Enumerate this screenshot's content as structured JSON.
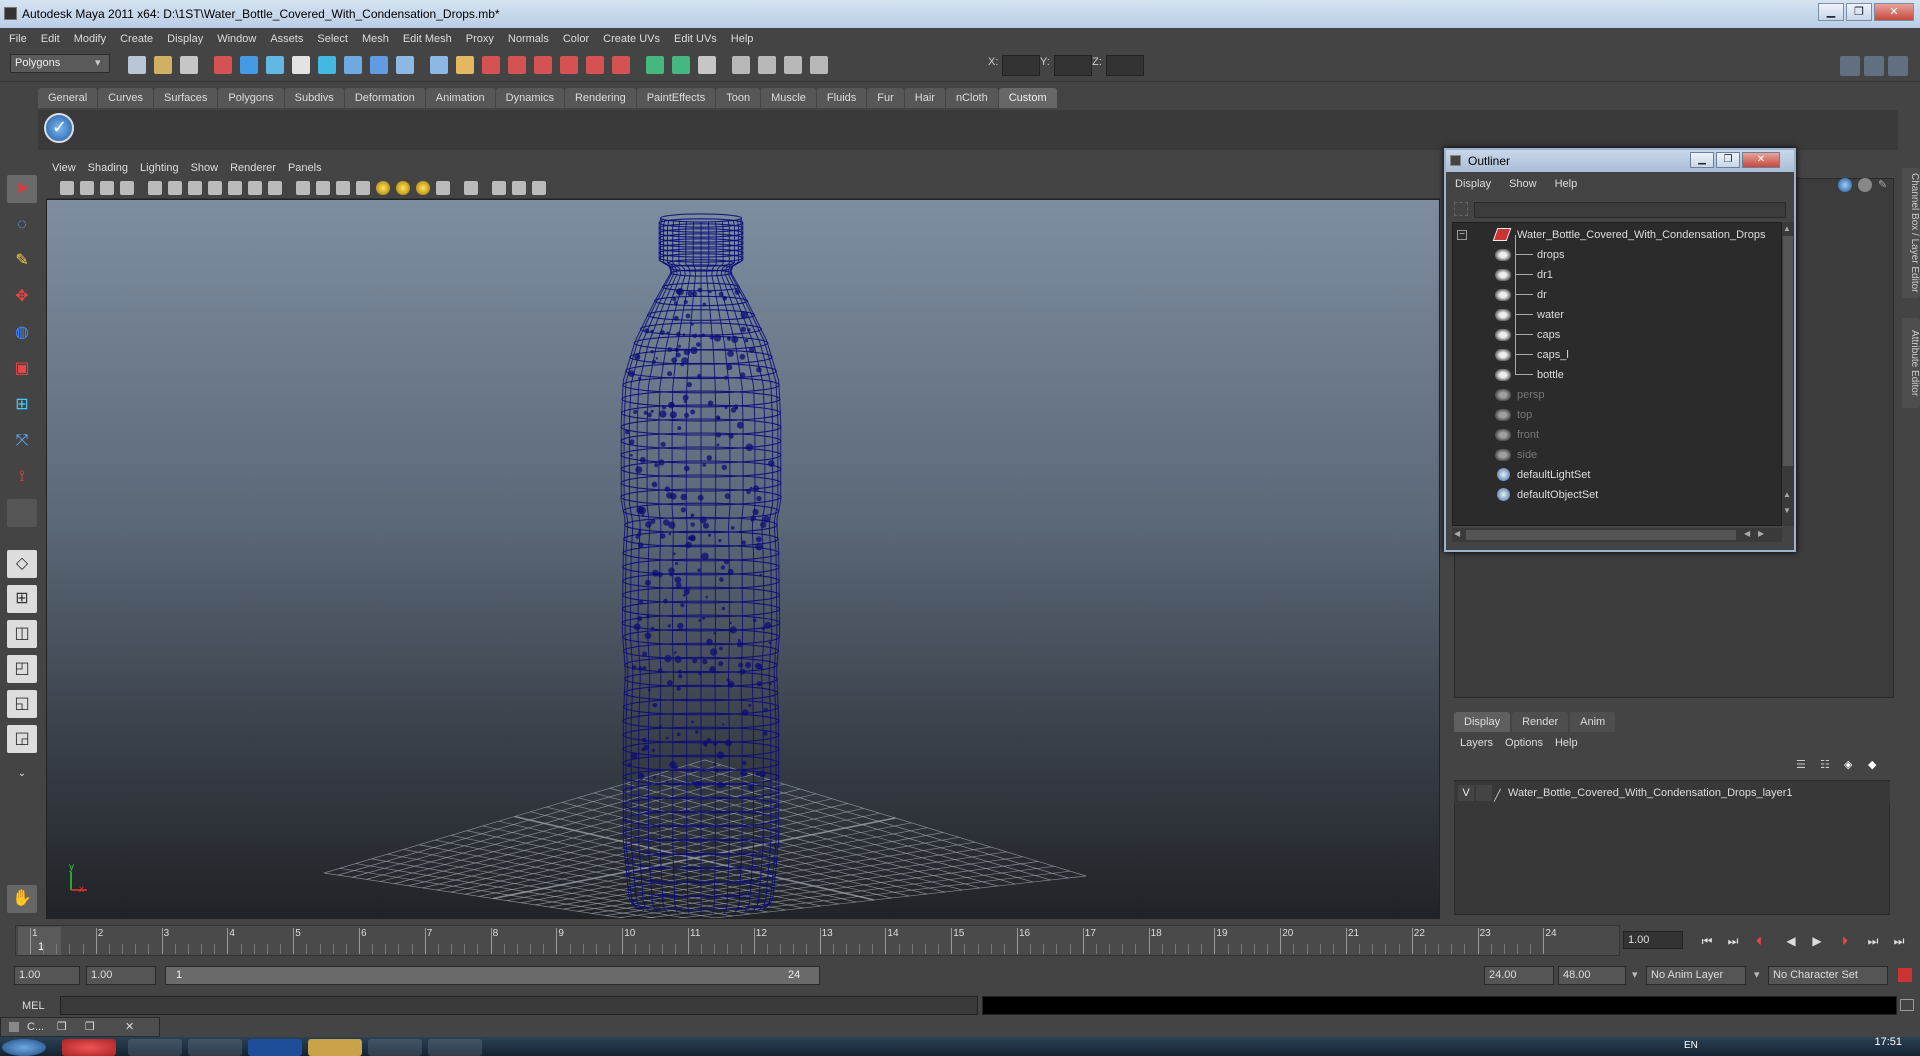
{
  "window": {
    "title": "Autodesk Maya 2011 x64: D:\\1ST\\Water_Bottle_Covered_With_Condensation_Drops.mb*",
    "minimize": "▁",
    "maximize": "❐",
    "close": "✕"
  },
  "menus": [
    "File",
    "Edit",
    "Modify",
    "Create",
    "Display",
    "Window",
    "Assets",
    "Select",
    "Mesh",
    "Edit Mesh",
    "Proxy",
    "Normals",
    "Color",
    "Create UVs",
    "Edit UVs",
    "Help"
  ],
  "toolbar": {
    "mode_select": "Polygons",
    "x_label": "X:",
    "y_label": "Y:",
    "z_label": "Z:"
  },
  "shelf_tabs": [
    "General",
    "Curves",
    "Surfaces",
    "Polygons",
    "Subdivs",
    "Deformation",
    "Animation",
    "Dynamics",
    "Rendering",
    "PaintEffects",
    "Toon",
    "Muscle",
    "Fluids",
    "Fur",
    "Hair",
    "nCloth",
    "Custom"
  ],
  "viewport": {
    "menus": [
      "View",
      "Shading",
      "Lighting",
      "Show",
      "Renderer",
      "Panels"
    ],
    "axis_y": "y",
    "axis_x": "x",
    "wire_color": "#0c0c78",
    "grid_color": "#9aa0a8"
  },
  "outliner": {
    "title": "Outliner",
    "menus": [
      "Display",
      "Show",
      "Help"
    ],
    "root": "Water_Bottle_Covered_With_Condensation_Drops",
    "children": [
      "drops",
      "dr1",
      "dr",
      "water",
      "caps",
      "caps_l",
      "bottle"
    ],
    "cameras": [
      "persp",
      "top",
      "front",
      "side"
    ],
    "sets": [
      "defaultLightSet",
      "defaultObjectSet"
    ]
  },
  "right_panel": {
    "vtab1": "Channel Box / Layer Editor",
    "vtab2": "Attribute Editor"
  },
  "layer_editor": {
    "tabs": [
      "Display",
      "Render",
      "Anim"
    ],
    "menus": [
      "Layers",
      "Options",
      "Help"
    ],
    "layer_v": "V",
    "layer_name": "Water_Bottle_Covered_With_Condensation_Drops_layer1"
  },
  "timeline": {
    "ticks": [
      "1",
      "2",
      "3",
      "4",
      "5",
      "6",
      "7",
      "8",
      "9",
      "10",
      "11",
      "12",
      "13",
      "14",
      "15",
      "16",
      "17",
      "18",
      "19",
      "20",
      "21",
      "22",
      "23",
      "24"
    ],
    "current_frame": "1",
    "current_time": "1.00"
  },
  "range": {
    "start": "1.00",
    "playback_start": "1.00",
    "range_start": "1",
    "range_end": "24",
    "playback_end": "24.00",
    "end": "48.00",
    "anim_layer": "No Anim Layer",
    "char_set": "No Character Set"
  },
  "command": {
    "label": "MEL"
  },
  "minimized_window": {
    "label": "C..."
  },
  "taskbar": {
    "lang": "EN",
    "time": "17:51"
  }
}
